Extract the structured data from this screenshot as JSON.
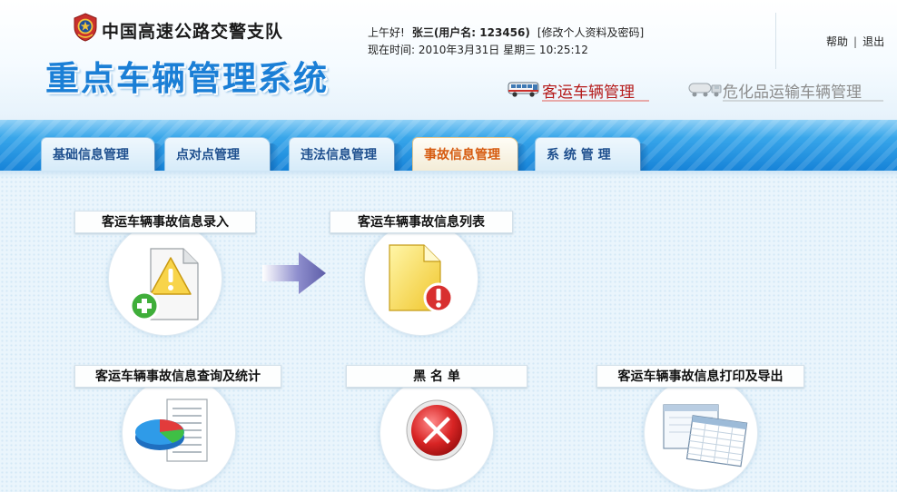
{
  "header": {
    "org_name": "中国高速公路交警支队",
    "system_title": "重点车辆管理系统",
    "greeting": "上午好!",
    "user_display": "张三(用户名: 123456)",
    "edit_profile_link": "[修改个人资料及密码]",
    "current_time": "现在时间: 2010年3月31日 星期三 10:25:12",
    "help_link": "帮助",
    "separator": "|",
    "logout_link": "退出",
    "modules": [
      {
        "label": "客运车辆管理",
        "icon": "bus-icon",
        "active": true
      },
      {
        "label": "危化品运输车辆管理",
        "icon": "tanker-truck-icon",
        "active": false
      }
    ]
  },
  "nav": {
    "tabs": [
      {
        "label": "基础信息管理",
        "active": false
      },
      {
        "label": "点对点管理",
        "active": false
      },
      {
        "label": "违法信息管理",
        "active": false
      },
      {
        "label": "事故信息管理",
        "active": true
      },
      {
        "label": "系 统 管 理",
        "active": false
      }
    ]
  },
  "main": {
    "items": [
      {
        "label": "客运车辆事故信息录入",
        "icon": "document-warning-add-icon"
      },
      {
        "label": "客运车辆事故信息列表",
        "icon": "document-error-icon"
      },
      {
        "label": "客运车辆事故信息查询及统计",
        "icon": "pie-chart-report-icon"
      },
      {
        "label": "黑 名 单",
        "icon": "red-x-icon"
      },
      {
        "label": "客运车辆事故信息打印及导出",
        "icon": "spreadsheet-windows-icon"
      }
    ]
  },
  "colors": {
    "title_blue": "#1b7fd6",
    "active_module_red": "#b51a1a",
    "active_tab_orange": "#d65b10",
    "nav_blue": "#1683d8"
  }
}
